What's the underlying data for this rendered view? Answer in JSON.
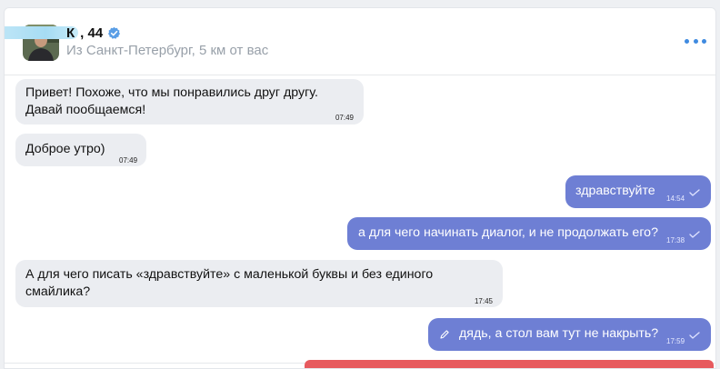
{
  "header": {
    "name_visible": "К",
    "name_suffix": ", 44",
    "location": "Из Санкт-Петербург, 5 км от вас"
  },
  "messages": [
    {
      "direction": "in",
      "text_line1": "Привет! Похоже, что мы понравились друг другу.",
      "text_line2": "Давай пообщаемся!",
      "time": "07:49"
    },
    {
      "direction": "in",
      "text": "Доброе утро)",
      "time": "07:49"
    },
    {
      "direction": "out",
      "text": "здравствуйте",
      "time": "14:54"
    },
    {
      "direction": "out",
      "text": "а для чего начинать диалог, и не продолжать его?",
      "time": "17:38"
    },
    {
      "direction": "in",
      "text_line1": "А для чего писать «здравствуйте» с маленькой буквы и без единого",
      "text_line2": "смайлика?",
      "time": "17:45"
    },
    {
      "direction": "out",
      "text": "дядь, а стол вам тут не накрыть?",
      "time": "17:59",
      "edited": true
    }
  ],
  "colors": {
    "outgoing_bubble": "#6e7fd4",
    "incoming_bubble": "#ebedf1",
    "accent": "#3f8ae0",
    "verified_badge": "#5a9ee6"
  },
  "icons": [
    "verified-icon",
    "more-icon",
    "read-check-icon",
    "edit-pencil-icon"
  ]
}
